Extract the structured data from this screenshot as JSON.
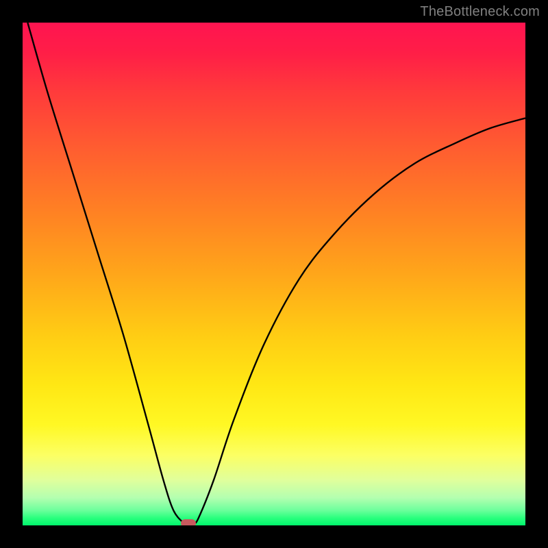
{
  "watermark": "TheBottleneck.com",
  "colors": {
    "frame": "#000000",
    "curve": "#000000",
    "marker": "#c65a5e"
  },
  "chart_data": {
    "type": "line",
    "title": "",
    "xlabel": "",
    "ylabel": "",
    "xlim": [
      0,
      100
    ],
    "ylim": [
      0,
      100
    ],
    "grid": false,
    "notes": "V-shaped bottleneck curve over a vertical green→yellow→red gradient. No axis tick labels or numeric annotations are present; values are approximate readings from the plot geometry.",
    "series": [
      {
        "name": "bottleneck-curve",
        "x": [
          1,
          5,
          10,
          15,
          20,
          25,
          28,
          30,
          32,
          33,
          34,
          35,
          38,
          42,
          48,
          55,
          62,
          70,
          78,
          86,
          93,
          100
        ],
        "y": [
          100,
          86,
          70,
          54,
          38,
          20,
          9,
          3,
          0.5,
          0,
          0.3,
          1.5,
          9,
          21,
          36,
          49,
          58,
          66,
          72,
          76,
          79,
          81
        ]
      }
    ],
    "annotations": [
      {
        "name": "min-marker",
        "x": 33,
        "y": 0,
        "shape": "pill",
        "color": "#c65a5e"
      }
    ]
  },
  "layout": {
    "image_size": 800,
    "plot_inset": 33
  }
}
